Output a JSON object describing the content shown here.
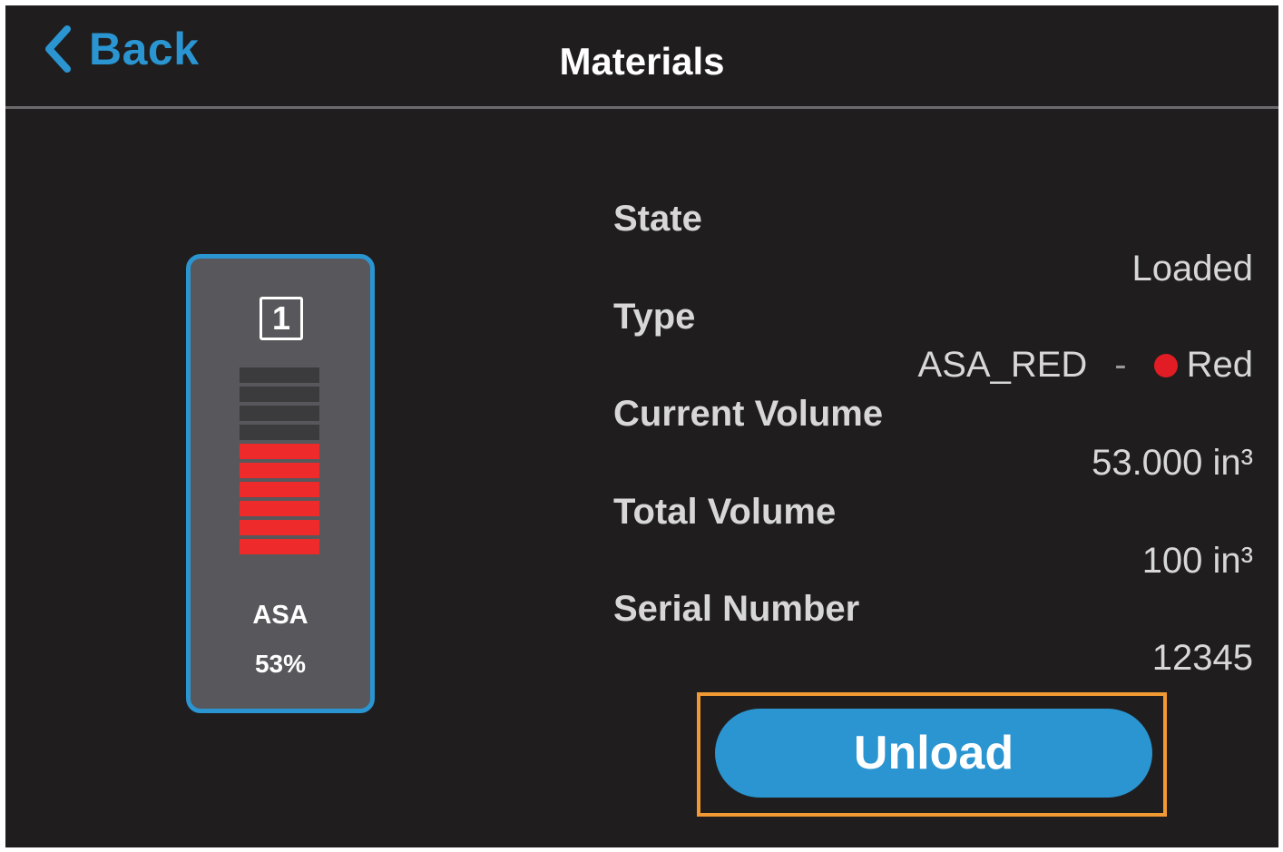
{
  "header": {
    "back_label": "Back",
    "title": "Materials",
    "accent_color": "#2a95d1"
  },
  "cartridge": {
    "slot_number": "1",
    "material": "ASA",
    "fill_percent_label": "53%",
    "fill_segments_total": 10,
    "fill_segments_filled": 6,
    "fill_color": "#ee2a2a"
  },
  "details": {
    "state_label": "State",
    "state_value": "Loaded",
    "type_label": "Type",
    "type_value": "ASA_RED",
    "type_separator": "-",
    "color_name": "Red",
    "color_hex": "#e21c24",
    "current_volume_label": "Current Volume",
    "current_volume_value": "53.000 in³",
    "total_volume_label": "Total Volume",
    "total_volume_value": "100 in³",
    "serial_label": "Serial Number",
    "serial_value": "12345"
  },
  "actions": {
    "unload_label": "Unload"
  }
}
